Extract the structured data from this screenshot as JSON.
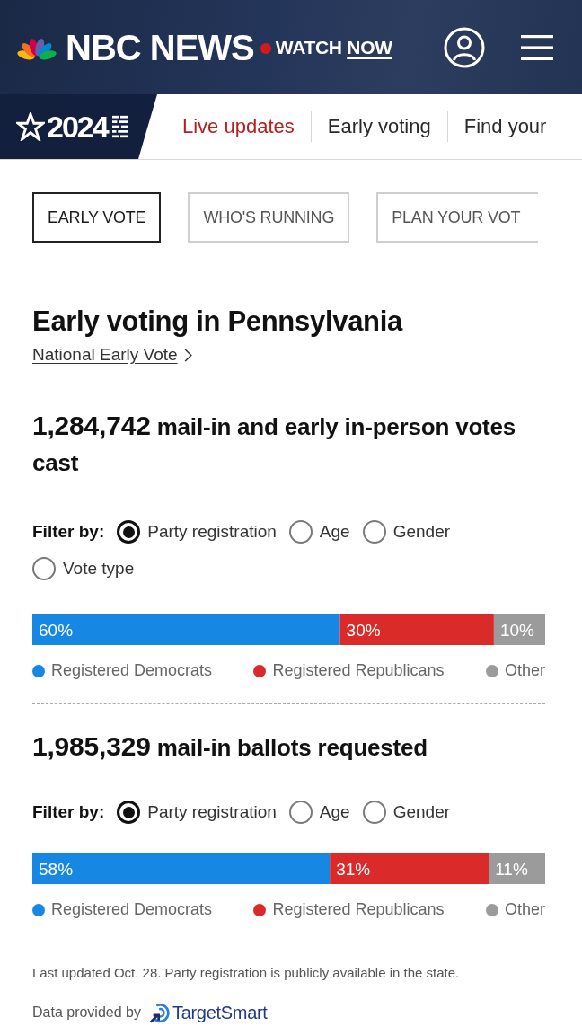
{
  "header": {
    "brand": "NBC NEWS",
    "watch": {
      "prefix": "WATCH",
      "link": "NOW"
    }
  },
  "election_nav": {
    "logo_year": "2024",
    "tabs": [
      {
        "label": "Live updates",
        "live": true
      },
      {
        "label": "Early voting",
        "live": false
      },
      {
        "label": "Find your",
        "live": false
      }
    ]
  },
  "section_tabs": [
    {
      "label": "EARLY VOTE",
      "selected": true
    },
    {
      "label": "WHO'S RUNNING",
      "selected": false
    },
    {
      "label": "PLAN YOUR VOT",
      "selected": false
    }
  ],
  "title": "Early voting in Pennsylvania",
  "national_link": "National Early Vote",
  "panels": [
    {
      "headline": "**1,284,742** mail-in and early in-person votes cast",
      "filter_label": "Filter by:",
      "filters": [
        {
          "label": "Party registration",
          "selected": true
        },
        {
          "label": "Age",
          "selected": false
        },
        {
          "label": "Gender",
          "selected": false
        },
        {
          "label": "Vote type",
          "selected": false
        }
      ],
      "chart_data": {
        "type": "bar",
        "orientation": "horizontal",
        "stacked": true,
        "legend": "bottom",
        "categories": [
          null
        ],
        "series": [
          {
            "name": "Registered Democrats",
            "color": "#1787e4",
            "values": [
              60
            ],
            "value_labels": [
              "60%"
            ]
          },
          {
            "name": "Registered Republicans",
            "color": "#db2a2a",
            "values": [
              30
            ],
            "value_labels": [
              "30%"
            ]
          },
          {
            "name": "Other",
            "color": "#9b9b9b",
            "values": [
              10
            ],
            "value_labels": [
              "10%"
            ]
          }
        ]
      }
    },
    {
      "headline": "**1,985,329** mail-in ballots requested",
      "filter_label": "Filter by:",
      "filters": [
        {
          "label": "Party registration",
          "selected": true
        },
        {
          "label": "Age",
          "selected": false
        },
        {
          "label": "Gender",
          "selected": false
        }
      ],
      "chart_data": {
        "type": "bar",
        "orientation": "horizontal",
        "stacked": true,
        "legend": "bottom",
        "categories": [
          null
        ],
        "series": [
          {
            "name": "Registered Democrats",
            "color": "#1787e4",
            "values": [
              58
            ],
            "value_labels": [
              "58%"
            ]
          },
          {
            "name": "Registered Republicans",
            "color": "#db2a2a",
            "values": [
              31
            ],
            "value_labels": [
              "31%"
            ]
          },
          {
            "name": "Other",
            "color": "#9b9b9b",
            "values": [
              11
            ],
            "value_labels": [
              "11%"
            ]
          }
        ]
      }
    }
  ],
  "footer": {
    "note": "Last updated Oct. 28. Party registration is publicly available in the state.",
    "credit": "Data provided by",
    "provider": "TargetSmart"
  }
}
